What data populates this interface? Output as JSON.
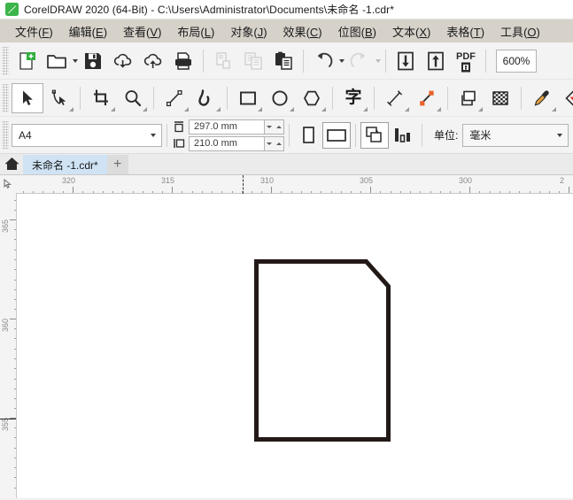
{
  "window": {
    "title": "CorelDRAW 2020 (64-Bit) - C:\\Users\\Administrator\\Documents\\未命名 -1.cdr*",
    "logo_icon": "coreldraw-logo-icon",
    "logo_color": "#3cb54a"
  },
  "menubar": {
    "items": [
      {
        "label": "文件",
        "mnemonic": "F"
      },
      {
        "label": "编辑",
        "mnemonic": "E"
      },
      {
        "label": "查看",
        "mnemonic": "V"
      },
      {
        "label": "布局",
        "mnemonic": "L"
      },
      {
        "label": "对象",
        "mnemonic": "J"
      },
      {
        "label": "效果",
        "mnemonic": "C"
      },
      {
        "label": "位图",
        "mnemonic": "B"
      },
      {
        "label": "文本",
        "mnemonic": "X"
      },
      {
        "label": "表格",
        "mnemonic": "T"
      },
      {
        "label": "工具",
        "mnemonic": "O"
      }
    ]
  },
  "standard_toolbar": {
    "buttons": [
      {
        "name": "new-document-icon",
        "enabled": true
      },
      {
        "name": "open-document-icon",
        "enabled": true,
        "has_dropdown": true
      },
      {
        "name": "save-icon",
        "enabled": true
      },
      {
        "name": "cloud-download-icon",
        "enabled": true
      },
      {
        "name": "cloud-upload-icon",
        "enabled": true
      },
      {
        "name": "print-icon",
        "enabled": true
      },
      {
        "name": "cut-icon",
        "enabled": false
      },
      {
        "name": "copy-icon",
        "enabled": false
      },
      {
        "name": "paste-icon",
        "enabled": true
      },
      {
        "name": "undo-icon",
        "enabled": true,
        "has_dropdown": true
      },
      {
        "name": "redo-icon",
        "enabled": false,
        "has_dropdown": true
      },
      {
        "name": "import-icon",
        "enabled": true
      },
      {
        "name": "export-icon",
        "enabled": true
      },
      {
        "name": "export-pdf-icon",
        "enabled": true,
        "label": "PDF"
      }
    ],
    "zoom_level": "600%"
  },
  "toolbox": {
    "active_tool": "pick-tool",
    "tools": [
      {
        "name": "pick-tool",
        "active": true,
        "flyout": false
      },
      {
        "name": "shape-tool",
        "active": false,
        "flyout": true
      },
      {
        "name": "crop-tool",
        "active": false,
        "flyout": true
      },
      {
        "name": "zoom-tool",
        "active": false,
        "flyout": true
      },
      {
        "name": "freehand-tool",
        "active": false,
        "flyout": true
      },
      {
        "name": "artistic-media-tool",
        "active": false,
        "flyout": true
      },
      {
        "name": "rectangle-tool",
        "active": false,
        "flyout": true
      },
      {
        "name": "ellipse-tool",
        "active": false,
        "flyout": true
      },
      {
        "name": "polygon-tool",
        "active": false,
        "flyout": true
      },
      {
        "name": "text-tool",
        "active": false,
        "flyout": true,
        "label": "字"
      },
      {
        "name": "parallel-dimension-tool",
        "active": false,
        "flyout": true
      },
      {
        "name": "straight-line-connector-tool",
        "active": false,
        "flyout": true
      },
      {
        "name": "drop-shadow-tool",
        "active": false,
        "flyout": true
      },
      {
        "name": "transparency-tool",
        "active": false,
        "flyout": false
      },
      {
        "name": "color-eyedropper-tool",
        "active": false,
        "flyout": true
      },
      {
        "name": "interactive-fill-tool",
        "active": false,
        "flyout": true
      }
    ]
  },
  "property_bar": {
    "page_size": "A4",
    "page_width": "297.0 mm",
    "page_height": "210.0 mm",
    "orientation_selected": "landscape",
    "portrait_icon": "portrait-orientation-icon",
    "landscape_icon": "landscape-orientation-icon",
    "page_options_icon": "page-layout-options-icon",
    "nudge_icon": "nudge-settings-icon",
    "units_label": "单位:",
    "units_value": "毫米"
  },
  "tabbar": {
    "home_icon": "home-icon",
    "active_tab": "未命名 -1.cdr*",
    "add_tab_label": "+"
  },
  "rulers": {
    "corner_icon": "ruler-origin-icon",
    "horizontal_labels": [
      "320",
      "315",
      "310",
      "305",
      "300",
      "2"
    ],
    "vertical_labels": [
      "365",
      "360",
      "355"
    ],
    "unit": "mm"
  },
  "canvas": {
    "background": "#ffffff",
    "shape": {
      "name": "chamfered-rectangle",
      "stroke_color": "#231a18",
      "stroke_width_px": 5,
      "fill": "none"
    }
  }
}
